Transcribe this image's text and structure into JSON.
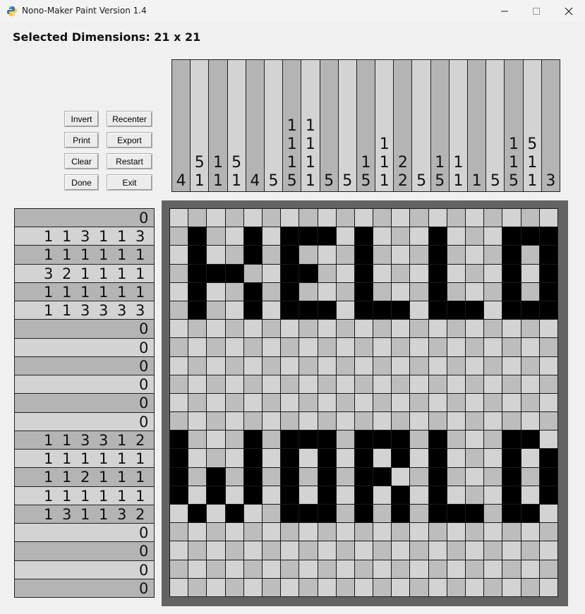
{
  "window": {
    "title": "Nono-Maker Paint Version 1.4",
    "controls": [
      "minimize-icon",
      "maximize-icon",
      "close-icon"
    ]
  },
  "header": {
    "dimensions_label": "Selected Dimensions: 21 x 21"
  },
  "buttons": {
    "invert": "Invert",
    "recenter": "Recenter",
    "print": "Print",
    "export": "Export",
    "clear": "Clear",
    "restart": "Restart",
    "done": "Done",
    "exit": "Exit"
  },
  "colors": {
    "filled": "#000000",
    "empty_light": "#d3d3d3",
    "empty_dark": "#bdbdbd",
    "clue_light": "#d3d3d3",
    "clue_dark": "#b4b4b4",
    "frame": "#636363"
  },
  "puzzle": {
    "size": 21,
    "column_clues": [
      [
        "4"
      ],
      [
        "5",
        "1"
      ],
      [
        "1",
        "1"
      ],
      [
        "5",
        "1"
      ],
      [
        "4"
      ],
      [
        "5"
      ],
      [
        "1",
        "1",
        "1",
        "5"
      ],
      [
        "1",
        "1",
        "1",
        "1"
      ],
      [
        "5"
      ],
      [
        "5"
      ],
      [
        "1",
        "5"
      ],
      [
        "1",
        "1",
        "1"
      ],
      [
        "2",
        "2"
      ],
      [
        "5"
      ],
      [
        "1",
        "5"
      ],
      [
        "1",
        "1"
      ],
      [
        "1"
      ],
      [
        "5"
      ],
      [
        "1",
        "1",
        "5"
      ],
      [
        "5",
        "1",
        "1"
      ],
      [
        "3"
      ]
    ],
    "row_clues": [
      [
        "0"
      ],
      [
        "1",
        "1",
        "3",
        "1",
        "1",
        "3"
      ],
      [
        "1",
        "1",
        "1",
        "1",
        "1",
        "1"
      ],
      [
        "3",
        "2",
        "1",
        "1",
        "1",
        "1"
      ],
      [
        "1",
        "1",
        "1",
        "1",
        "1",
        "1"
      ],
      [
        "1",
        "1",
        "3",
        "3",
        "3",
        "3"
      ],
      [
        "0"
      ],
      [
        "0"
      ],
      [
        "0"
      ],
      [
        "0"
      ],
      [
        "0"
      ],
      [
        "0"
      ],
      [
        "1",
        "1",
        "3",
        "3",
        "1",
        "2"
      ],
      [
        "1",
        "1",
        "1",
        "1",
        "1",
        "1"
      ],
      [
        "1",
        "1",
        "2",
        "1",
        "1",
        "1"
      ],
      [
        "1",
        "1",
        "1",
        "1",
        "1",
        "1"
      ],
      [
        "1",
        "3",
        "1",
        "1",
        "3",
        "2"
      ],
      [
        "0"
      ],
      [
        "0"
      ],
      [
        "0"
      ],
      [
        "0"
      ]
    ],
    "grid_rows": [
      ".....................",
      ".#..#.###.#...#...###",
      ".#..#.#...#...#...#.#",
      ".###..##..#...#...#.#",
      ".#..#.#...#...#...#.#",
      ".#..#.###.###.###.###",
      ".....................",
      ".....................",
      ".....................",
      ".....................",
      ".....................",
      ".....................",
      "#...#.###.###.#...##.",
      "#...#.#.#.#.#.#...#.#",
      "#.#.#.#.#.##..#...#.#",
      "#.#.#.#.#.#.#.#...#.#",
      ".#.#..###.#.#.###.##.",
      ".....................",
      ".....................",
      ".....................",
      "....................."
    ]
  }
}
